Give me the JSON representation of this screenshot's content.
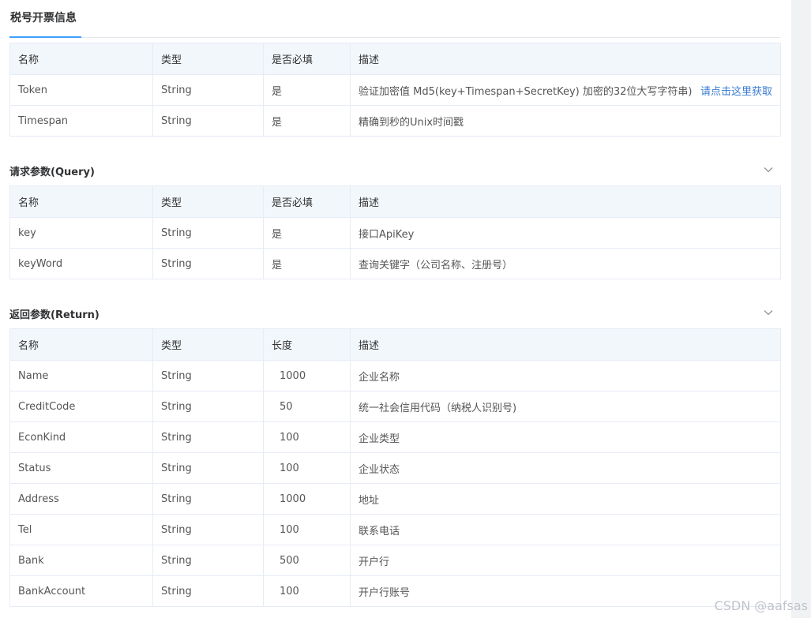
{
  "tab": {
    "label": "税号开票信息"
  },
  "header_table": {
    "columns": [
      "名称",
      "类型",
      "是否必填",
      "描述"
    ],
    "rows": [
      {
        "name": "Token",
        "type": "String",
        "required": "是",
        "desc": "验证加密值 Md5(key+Timespan+SecretKey) 加密的32位大写字符串)",
        "link": "请点击这里获取"
      },
      {
        "name": "Timespan",
        "type": "String",
        "required": "是",
        "desc": "精确到秒的Unix时间戳"
      }
    ]
  },
  "query_section": {
    "title": "请求参数(Query)",
    "columns": [
      "名称",
      "类型",
      "是否必填",
      "描述"
    ],
    "rows": [
      {
        "name": "key",
        "type": "String",
        "required": "是",
        "desc": "接口ApiKey"
      },
      {
        "name": "keyWord",
        "type": "String",
        "required": "是",
        "desc": "查询关键字（公司名称、注册号）"
      }
    ]
  },
  "return_section": {
    "title": "返回参数(Return)",
    "columns": [
      "名称",
      "类型",
      "长度",
      "描述"
    ],
    "rows": [
      {
        "name": "Name",
        "type": "String",
        "length": "1000",
        "desc": "企业名称"
      },
      {
        "name": "CreditCode",
        "type": "String",
        "length": "50",
        "desc": "统一社会信用代码（纳税人识别号)"
      },
      {
        "name": "EconKind",
        "type": "String",
        "length": "100",
        "desc": "企业类型"
      },
      {
        "name": "Status",
        "type": "String",
        "length": "100",
        "desc": "企业状态"
      },
      {
        "name": "Address",
        "type": "String",
        "length": "1000",
        "desc": "地址"
      },
      {
        "name": "Tel",
        "type": "String",
        "length": "100",
        "desc": "联系电话"
      },
      {
        "name": "Bank",
        "type": "String",
        "length": "500",
        "desc": "开户行"
      },
      {
        "name": "BankAccount",
        "type": "String",
        "length": "100",
        "desc": "开户行账号"
      }
    ]
  },
  "watermark": "CSDN @aafsas",
  "colors": {
    "accent": "#409eff",
    "link": "#3a7bd5",
    "header_bg": "#f2f7fc",
    "border": "#e6ebf5"
  },
  "icons": {
    "collapse": "chevron-down-icon"
  }
}
